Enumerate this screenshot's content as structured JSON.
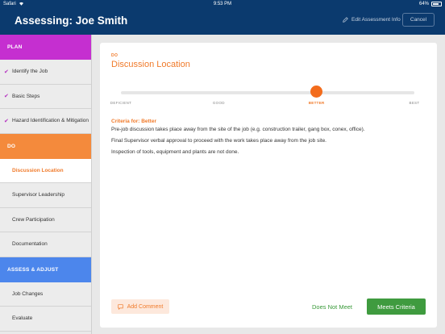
{
  "status_bar": {
    "carrier": "Safari",
    "time": "9:53 PM",
    "battery": "64%",
    "battery_level": 0.64
  },
  "header": {
    "title": "Assessing: Joe Smith",
    "edit_label": "Edit Assessment Info",
    "cancel_label": "Cancel"
  },
  "sidebar": {
    "plan": {
      "label": "PLAN",
      "items": [
        {
          "label": "Identify the Job"
        },
        {
          "label": "Basic Steps"
        },
        {
          "label": "Hazard Identification & Mitigation"
        }
      ]
    },
    "do": {
      "label": "DO",
      "items": [
        {
          "label": "Discussion Location"
        },
        {
          "label": "Supervisor Leadership"
        },
        {
          "label": "Crew Participation"
        },
        {
          "label": "Documentation"
        }
      ]
    },
    "assess": {
      "label": "ASSESS & ADJUST",
      "items": [
        {
          "label": "Job Changes"
        },
        {
          "label": "Evaluate"
        }
      ]
    }
  },
  "main": {
    "tag": "DO",
    "title": "Discussion Location",
    "scale": {
      "labels": [
        "DEFICIENT",
        "GOOD",
        "BETTER",
        "BEST"
      ],
      "selected_index": 2
    },
    "criteria_title": "Criteria for: Better",
    "criteria": [
      "Pre-job discussion takes place away from the site of the job (e.g. construction trailer, gang box, conex, office).",
      "Final Supervisor verbal approval to proceed with the work takes place away from the job site.",
      "Inspection of tools, equipment and plants are not done."
    ],
    "add_comment_label": "Add Comment",
    "does_not_meet_label": "Does Not Meet",
    "meets_label": "Meets Criteria"
  },
  "colors": {
    "navy": "#0b3a6e",
    "plan": "#c52fd0",
    "do": "#f48a3c",
    "assess": "#4c86ec",
    "accent": "#f36c1c",
    "green": "#3f9b3f"
  }
}
